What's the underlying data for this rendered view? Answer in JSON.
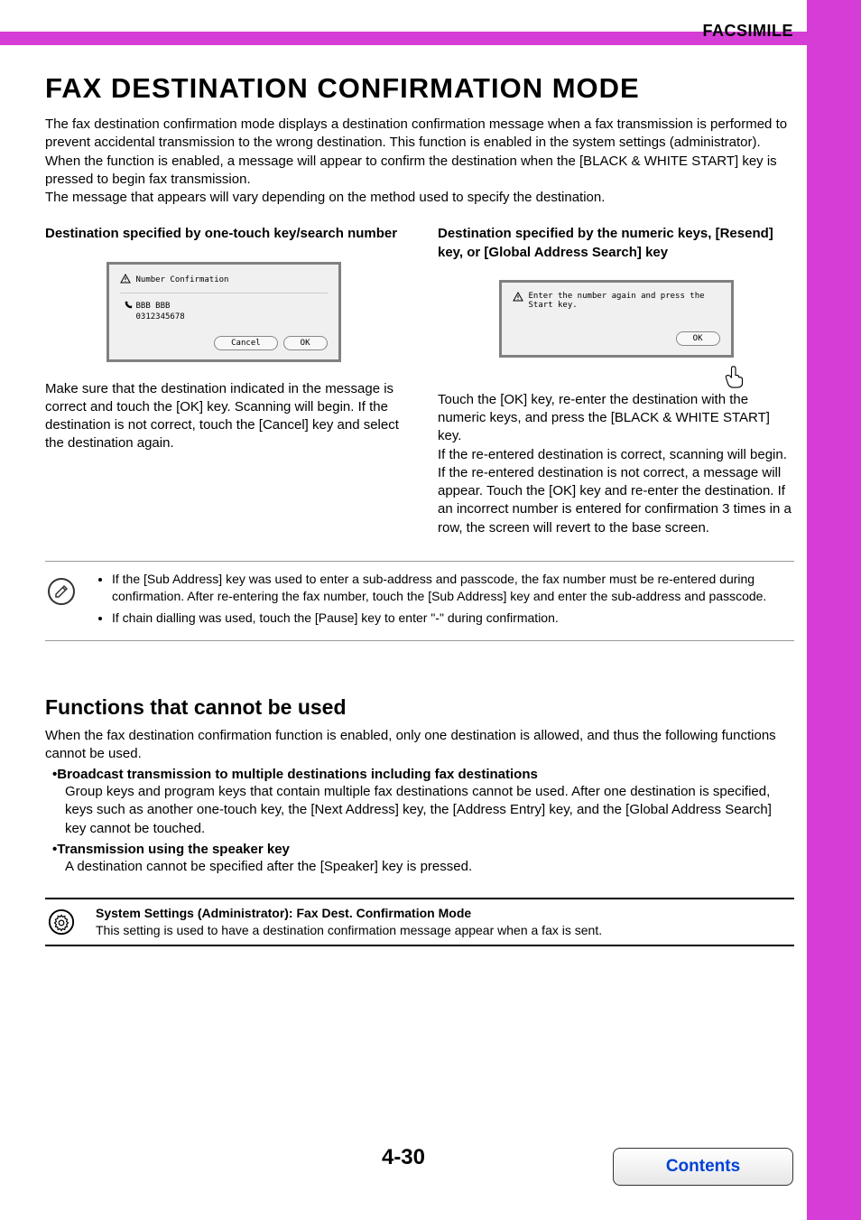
{
  "header": {
    "section_label": "FACSIMILE"
  },
  "main": {
    "heading": "FAX DESTINATION CONFIRMATION MODE",
    "intro": "The fax destination confirmation mode displays a destination confirmation message when a fax transmission is performed to prevent accidental transmission to the wrong destination. This function is enabled in the system settings (administrator). When the function is enabled, a message will appear to confirm the destination when the [BLACK & WHITE START] key is pressed to begin fax transmission.\nThe message that appears will vary depending on the method used to specify the destination."
  },
  "left_col": {
    "heading": "Destination specified by one-touch key/search number",
    "dialog": {
      "title": "Number Confirmation",
      "dest_name": "BBB BBB",
      "dest_number": "0312345678",
      "cancel_label": "Cancel",
      "ok_label": "OK"
    },
    "body": "Make sure that the destination indicated in the message is correct and touch the [OK] key. Scanning will begin. If the destination is not correct, touch the [Cancel] key and select the destination again."
  },
  "right_col": {
    "heading": "Destination specified by the numeric keys, [Resend] key, or [Global Address Search] key",
    "dialog": {
      "message": "Enter the number again and press the Start key.",
      "ok_label": "OK"
    },
    "body": "Touch the [OK] key, re-enter the destination with the numeric keys, and press the [BLACK & WHITE START] key.\nIf the re-entered destination is correct, scanning will begin.\nIf the re-entered destination is not correct, a message will appear. Touch the [OK] key and re-enter the destination. If an incorrect number is entered for confirmation 3 times in a row, the screen will revert to the base screen."
  },
  "notes": [
    "If the [Sub Address] key was used to enter a sub-address and passcode, the fax number must be re-entered during confirmation. After re-entering the fax number, touch the [Sub Address] key and enter the sub-address and passcode.",
    "If chain dialling was used, touch the [Pause] key to enter \"-\" during confirmation."
  ],
  "functions": {
    "heading": "Functions that cannot be used",
    "intro": "When the fax destination confirmation function is enabled, only one destination is allowed, and thus the following functions cannot be used.",
    "items": [
      {
        "title": "Broadcast transmission to multiple destinations including fax destinations",
        "body": "Group keys and program keys that contain multiple fax destinations cannot be used. After one destination is specified, keys such as another one-touch key, the [Next Address] key, the [Address Entry] key, and the [Global Address Search] key cannot be touched."
      },
      {
        "title": "Transmission using the speaker key",
        "body": "A destination cannot be specified after the [Speaker] key is pressed."
      }
    ]
  },
  "settings": {
    "title": "System Settings (Administrator): Fax Dest. Confirmation Mode",
    "body": "This setting is used to have a destination confirmation message appear when a fax is sent."
  },
  "footer": {
    "page_number": "4-30",
    "contents_label": "Contents"
  }
}
